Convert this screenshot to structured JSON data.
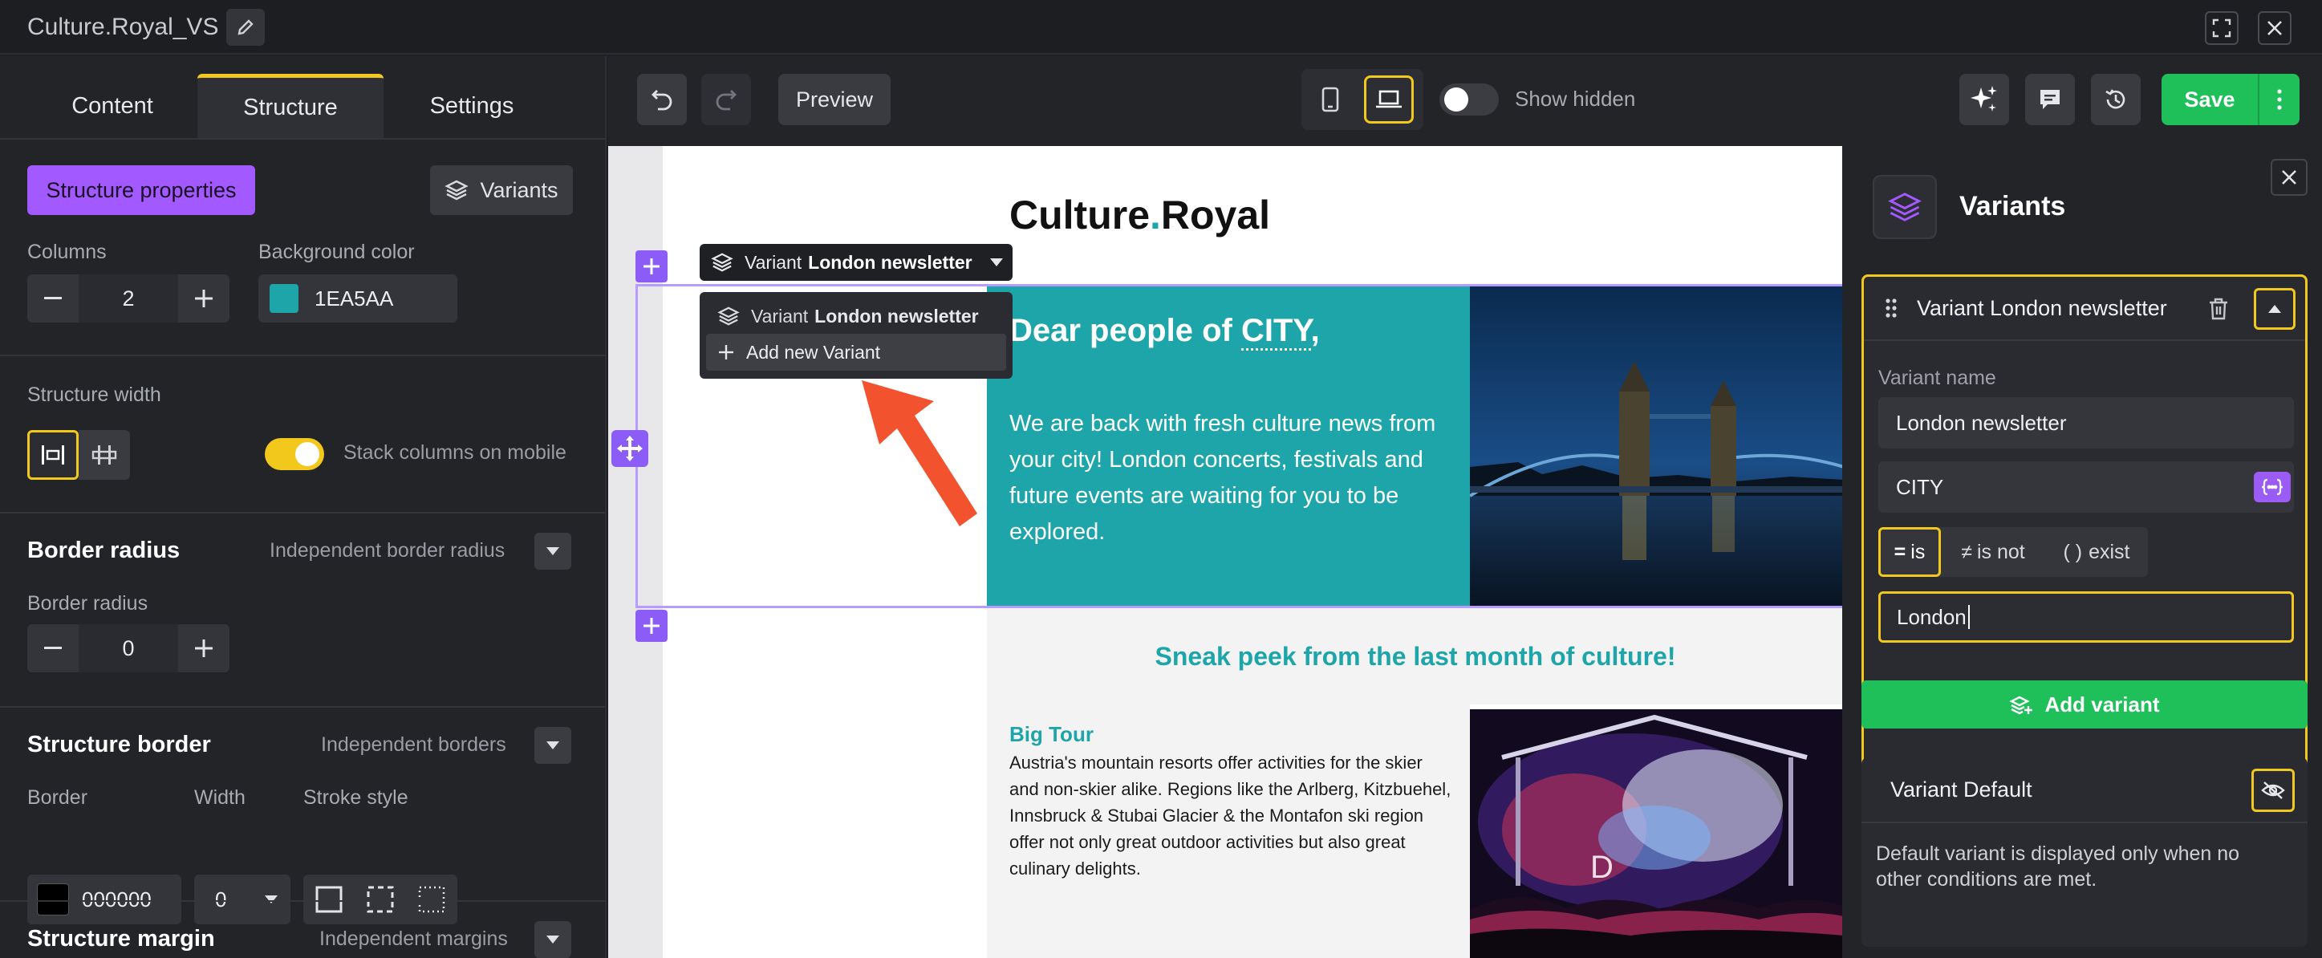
{
  "window": {
    "title": "Culture.Royal_VS"
  },
  "left_panel": {
    "tabs": [
      "Content",
      "Structure",
      "Settings"
    ],
    "structure_properties_label": "Structure properties",
    "variants_button_label": "Variants",
    "columns": {
      "label": "Columns",
      "value": "2"
    },
    "background_color": {
      "label": "Background color",
      "value": "1EA5AA",
      "swatch": "#1EA5AA"
    },
    "structure_width": {
      "label": "Structure width",
      "stack_label": "Stack columns on mobile"
    },
    "border_radius": {
      "title": "Border radius",
      "aux": "Independent border radius",
      "label": "Border radius",
      "value": "0"
    },
    "structure_border": {
      "title": "Structure border",
      "aux": "Independent borders",
      "border_label": "Border",
      "border_value": "000000",
      "width_label": "Width",
      "width_value": "0",
      "stroke_label": "Stroke style"
    },
    "structure_margin": {
      "title": "Structure margin",
      "aux": "Independent margins"
    }
  },
  "toolbar": {
    "preview_label": "Preview",
    "show_hidden_label": "Show hidden",
    "save_label": "Save"
  },
  "canvas": {
    "logo_part1": "Culture",
    "logo_dot": ".",
    "logo_part2": "Royal",
    "variant_tag": {
      "prefix": "Variant",
      "name": "London newsletter"
    },
    "dropdown": {
      "item_prefix": "Variant",
      "item_name": "London newsletter",
      "add_label": "Add new Variant"
    },
    "hero": {
      "heading_prefix": "Dear people of ",
      "heading_token": "CITY",
      "heading_suffix": ",",
      "body": "We are back with fresh culture news from your city! London concerts, festivals and future events are waiting for you to be explored."
    },
    "sneak_peek": "Sneak peek from the last month of culture!",
    "article": {
      "title": "Big Tour",
      "body": "Austria's mountain resorts offer activities for the skier and non-skier alike. Regions like the Arlberg, Kitzbuehel, Innsbruck & Stubai Glacier & the Montafon ski region offer not only great outdoor activities but also great culinary delights."
    }
  },
  "right_panel": {
    "title": "Variants",
    "variant_card": {
      "header": "Variant London newsletter",
      "name_label": "Variant name",
      "name_value": "London newsletter",
      "condition_field": "CITY",
      "operators": {
        "is": "is",
        "is_not": "is not",
        "exist": "exist"
      },
      "condition_value": "London"
    },
    "add_variant_label": "Add variant",
    "default_card": {
      "title": "Variant Default",
      "description": "Default variant is displayed only when no other conditions are met."
    }
  },
  "colors": {
    "accent_yellow": "#f2c81c",
    "purple": "#9b5cf6",
    "teal": "#1EA5AA",
    "green": "#1fbf5a"
  }
}
